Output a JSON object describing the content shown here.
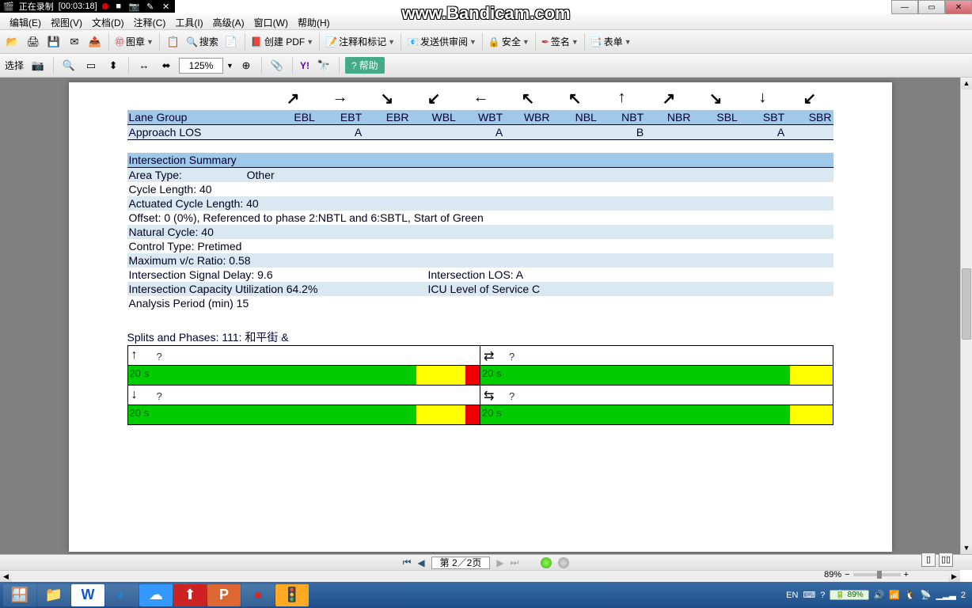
{
  "bandicam": {
    "status": "正在录制",
    "time": "[00:03:18]",
    "url": "www.Bandicam.com"
  },
  "menu": {
    "edit": "编辑(E)",
    "view": "视图(V)",
    "doc": "文档(D)",
    "comment": "注释(C)",
    "tool": "工具(I)",
    "adv": "高级(A)",
    "win": "窗口(W)",
    "help": "帮助(H)"
  },
  "tb1": {
    "stamp": "图章",
    "search": "搜索",
    "create_pdf": "创建 PDF",
    "annotate": "注释和标记",
    "send_review": "发送供审阅",
    "secure": "安全",
    "sign": "签名",
    "forms": "表单"
  },
  "tb2": {
    "select": "选择",
    "zoom": "125%",
    "help": "帮助"
  },
  "lane": {
    "group": "Lane Group",
    "cols": [
      "EBL",
      "EBT",
      "EBR",
      "WBL",
      "WBT",
      "WBR",
      "NBL",
      "NBT",
      "NBR",
      "SBL",
      "SBT",
      "SBR"
    ],
    "approach": "Approach LOS",
    "los": [
      "",
      "A",
      "",
      "",
      "A",
      "",
      "",
      "B",
      "",
      "",
      "A",
      ""
    ]
  },
  "summary": {
    "hdr": "Intersection Summary",
    "area": "Area Type:",
    "area_v": "Other",
    "cycle": "Cycle Length: 40",
    "act": "Actuated Cycle Length: 40",
    "offset": "Offset: 0 (0%), Referenced to phase 2:NBTL and 6:SBTL, Start of Green",
    "natural": "Natural Cycle: 40",
    "control": "Control Type: Pretimed",
    "maxvc": "Maximum v/c Ratio: 0.58",
    "isd": "Intersection Signal Delay: 9.6",
    "ilos": "Intersection LOS: A",
    "icu": "Intersection Capacity Utilization 64.2%",
    "iculvl": "ICU Level of Service C",
    "period": "Analysis Period (min) 15"
  },
  "splits": {
    "hdr": "Splits and Phases:     111: 和平街 &",
    "t1": "20 s",
    "t2": "20 s",
    "t3": "20 s",
    "t4": "20 s",
    "q": "?"
  },
  "pager": {
    "pages": "第 2／2页"
  },
  "status": {
    "zoom_pct": "89%",
    "lang": "EN",
    "battery": "89%",
    "time_short": "2"
  }
}
